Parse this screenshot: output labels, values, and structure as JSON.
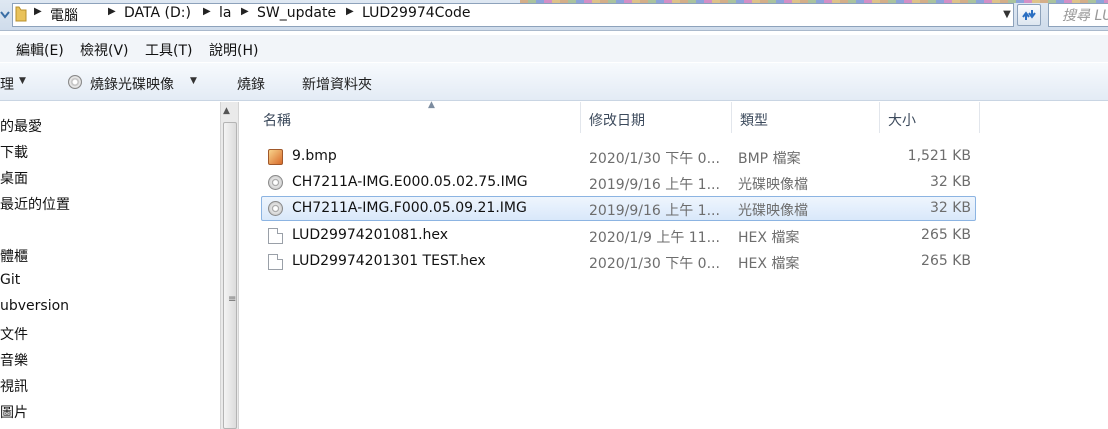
{
  "address": {
    "crumbs": [
      "電腦",
      "DATA (D:)",
      "la",
      "SW_update",
      "LUD29974Code"
    ],
    "search_placeholder": "搜尋 LU"
  },
  "menu": [
    "編輯(E)",
    "檢視(V)",
    "工具(T)",
    "說明(H)"
  ],
  "toolbar": {
    "organize": "理",
    "burn_image": "燒錄光碟映像",
    "burn": "燒錄",
    "new_folder": "新增資料夾"
  },
  "nav": [
    "的最愛",
    "下載",
    "桌面",
    "最近的位置",
    "體櫃",
    "Git",
    "ubversion",
    "文件",
    "音樂",
    "視訊",
    "圖片"
  ],
  "columns": {
    "name": "名稱",
    "date": "修改日期",
    "type": "類型",
    "size": "大小"
  },
  "files": [
    {
      "name": "9.bmp",
      "date": "2020/1/30 下午 0...",
      "type": "BMP 檔案",
      "size": "1,521 KB",
      "icon": "bmp-file-icon"
    },
    {
      "name": "CH7211A-IMG.E000.05.02.75.IMG",
      "date": "2019/9/16 上午 1...",
      "type": "光碟映像檔",
      "size": "32 KB",
      "icon": "disc-image-icon"
    },
    {
      "name": "CH7211A-IMG.F000.05.09.21.IMG",
      "date": "2019/9/16 上午 1...",
      "type": "光碟映像檔",
      "size": "32 KB",
      "icon": "disc-image-icon"
    },
    {
      "name": "LUD29974201081.hex",
      "date": "2020/1/9 上午 11...",
      "type": "HEX 檔案",
      "size": "265 KB",
      "icon": "document-icon"
    },
    {
      "name": "LUD29974201301 TEST.hex",
      "date": "2020/1/30 下午 0...",
      "type": "HEX 檔案",
      "size": "265 KB",
      "icon": "document-icon"
    }
  ]
}
